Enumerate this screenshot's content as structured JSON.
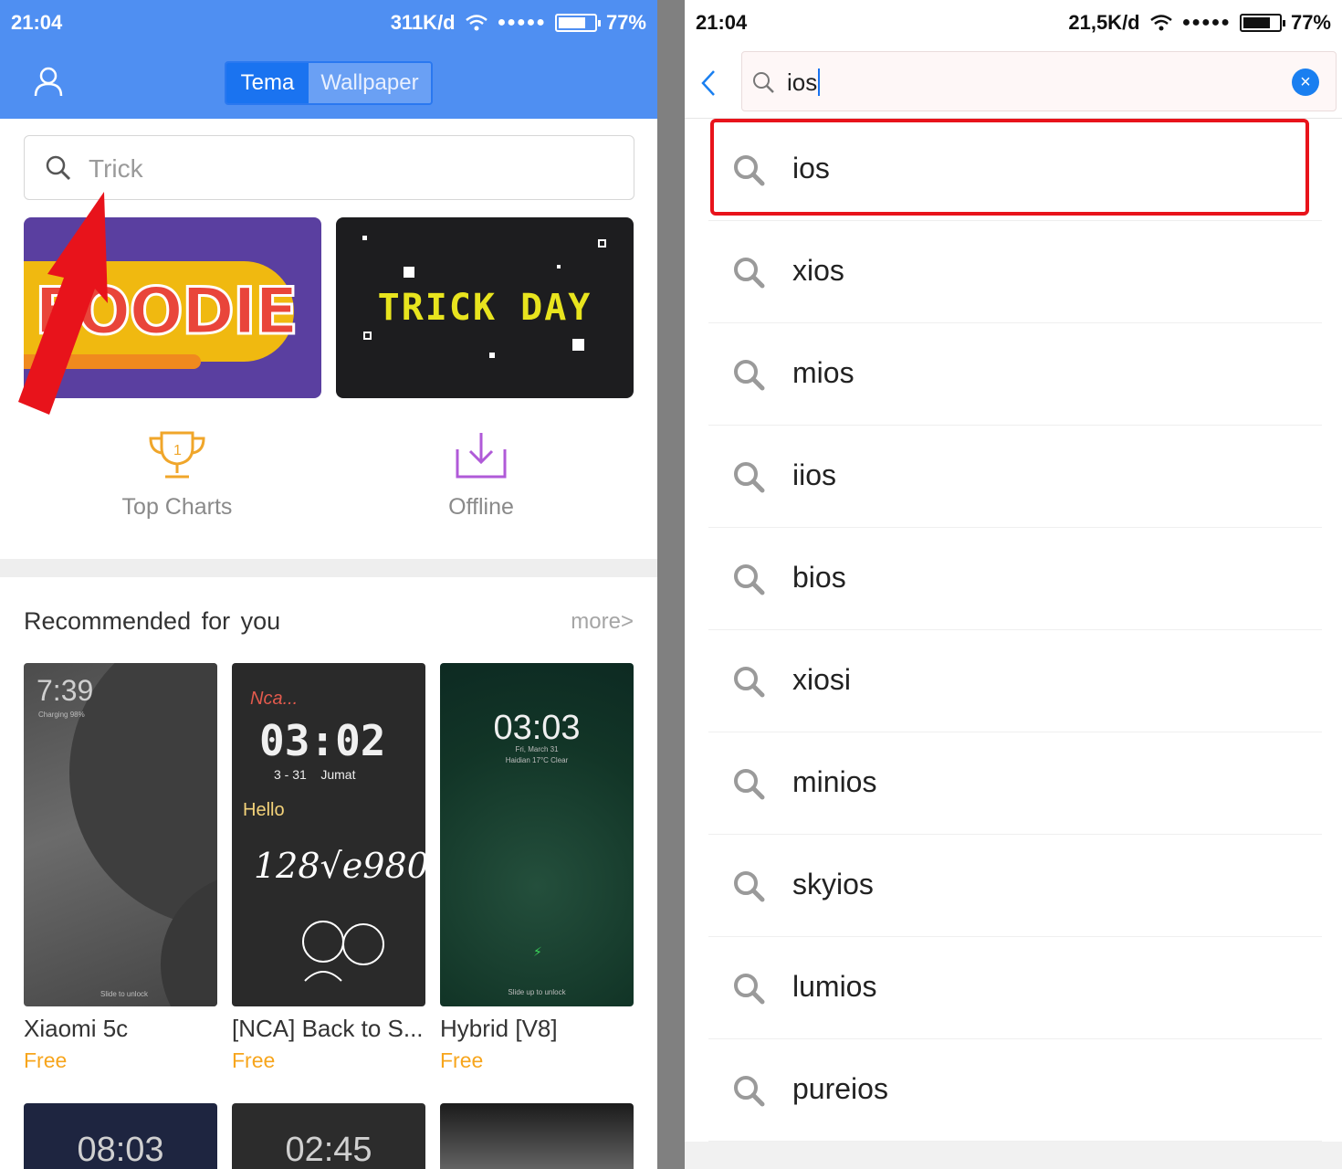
{
  "left": {
    "status": {
      "time": "21:04",
      "speed": "311K/d",
      "signal": "●●●●●",
      "battery": "77%",
      "battery_level": 0.77
    },
    "header": {
      "tabs": [
        {
          "label": "Tema",
          "active": true
        },
        {
          "label": "Wallpaper",
          "active": false
        }
      ]
    },
    "search": {
      "placeholder": "Trick"
    },
    "banners": [
      {
        "text": "FOODIE"
      },
      {
        "text": "TRICK DAY"
      }
    ],
    "quick_links": [
      {
        "label": "Top Charts",
        "icon": "trophy-icon"
      },
      {
        "label": "Offline",
        "icon": "download-icon"
      }
    ],
    "recommended": {
      "title": "Recommended for you",
      "more": "more>",
      "items": [
        {
          "name": "Xiaomi 5c",
          "price": "Free",
          "clock": "7:39",
          "sub": "Charging 98%",
          "hint": "Slide to unlock"
        },
        {
          "name": "[NCA] Back to S...",
          "price": "Free",
          "clock": "03:02",
          "sub": "3 - 31    Jumat",
          "hello": "Hello",
          "brand": "Nca...",
          "eq": "128√e980"
        },
        {
          "name": "Hybrid [V8]",
          "price": "Free",
          "clock": "03:03",
          "sub": "Fri, March 31",
          "sub2": "Haidian 17°C Clear",
          "hint": "Slide up to unlock"
        }
      ],
      "more_items": [
        {
          "clock": "08:03"
        },
        {
          "clock": "02:45"
        },
        {
          "clock": ""
        }
      ]
    },
    "annotation": {
      "color": "#e8131b"
    }
  },
  "right": {
    "status": {
      "time": "21:04",
      "speed": "21,5K/d",
      "signal": "●●●●●",
      "battery": "77%",
      "battery_level": 0.77
    },
    "search": {
      "value": "ios",
      "clear_icon": "×"
    },
    "suggestions": [
      "ios",
      "xios",
      "mios",
      "iios",
      "bios",
      "xiosi",
      "minios",
      "skyios",
      "lumios",
      "pureios"
    ],
    "highlight_color": "#e8131b"
  },
  "colors": {
    "header_blue": "#4f8ff2",
    "tab_active": "#1a73f0",
    "price": "#f7a51c",
    "accent": "#1a7ff0"
  }
}
